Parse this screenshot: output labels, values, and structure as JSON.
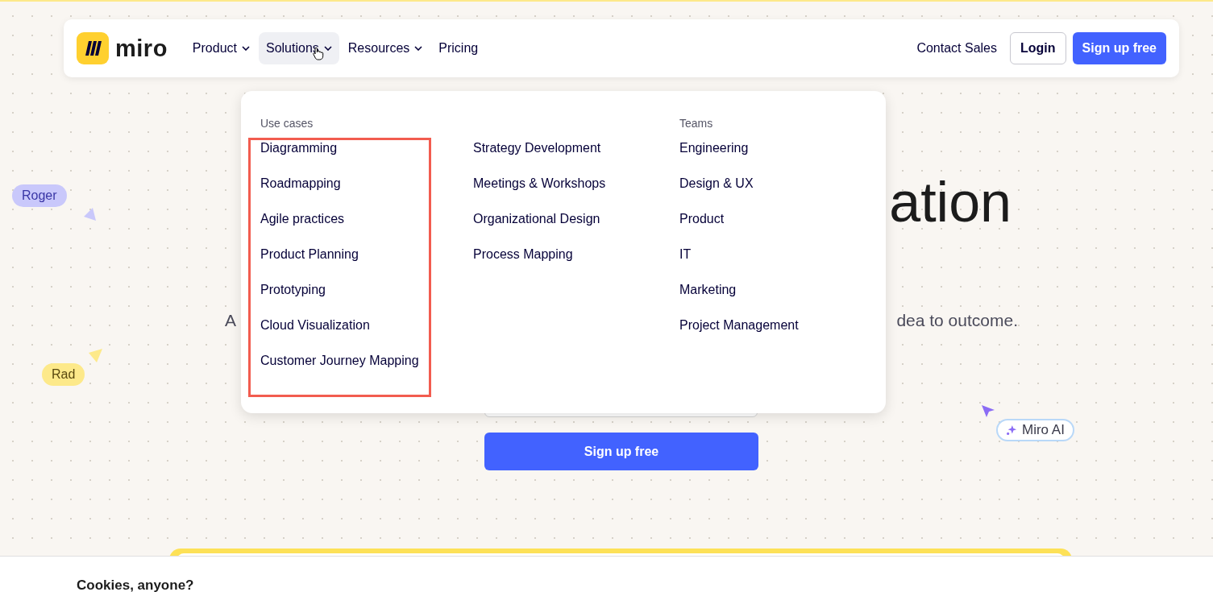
{
  "header": {
    "logo_text": "miro",
    "nav": [
      {
        "label": "Product",
        "dropdown": true,
        "selected": false
      },
      {
        "label": "Solutions",
        "dropdown": true,
        "selected": true
      },
      {
        "label": "Resources",
        "dropdown": true,
        "selected": false
      },
      {
        "label": "Pricing",
        "dropdown": false,
        "selected": false
      }
    ],
    "contact": "Contact Sales",
    "login": "Login",
    "signup": "Sign up free"
  },
  "menu": {
    "columns": [
      {
        "heading": "Use cases",
        "highlighted": true,
        "items": [
          "Diagramming",
          "Roadmapping",
          "Agile practices",
          "Product Planning",
          "Prototyping",
          "Cloud Visualization",
          "Customer Journey Mapping"
        ]
      },
      {
        "highlighted": false,
        "items": [
          "Strategy Development",
          "Meetings & Workshops",
          "Organizational Design",
          "Process Mapping"
        ]
      },
      {
        "heading": "Teams",
        "highlighted": false,
        "items": [
          "Engineering",
          "Design & UX",
          "Product",
          "IT",
          "Marketing",
          "Project Management"
        ]
      }
    ]
  },
  "hero": {
    "heading": "ation",
    "subtitle_fragments": [
      "A",
      "dea to outcome."
    ],
    "signup": "Sign up free"
  },
  "cursors": [
    {
      "label": "Roger",
      "kind": "arrow-right",
      "color": "#c9c8fb"
    },
    {
      "label": "Rad",
      "kind": "arrow-left",
      "color": "#fde98a"
    },
    {
      "label": "Miro AI",
      "kind": "ai",
      "color": "#8b6cf5"
    }
  ],
  "cookie_banner": {
    "title": "Cookies, anyone?"
  }
}
